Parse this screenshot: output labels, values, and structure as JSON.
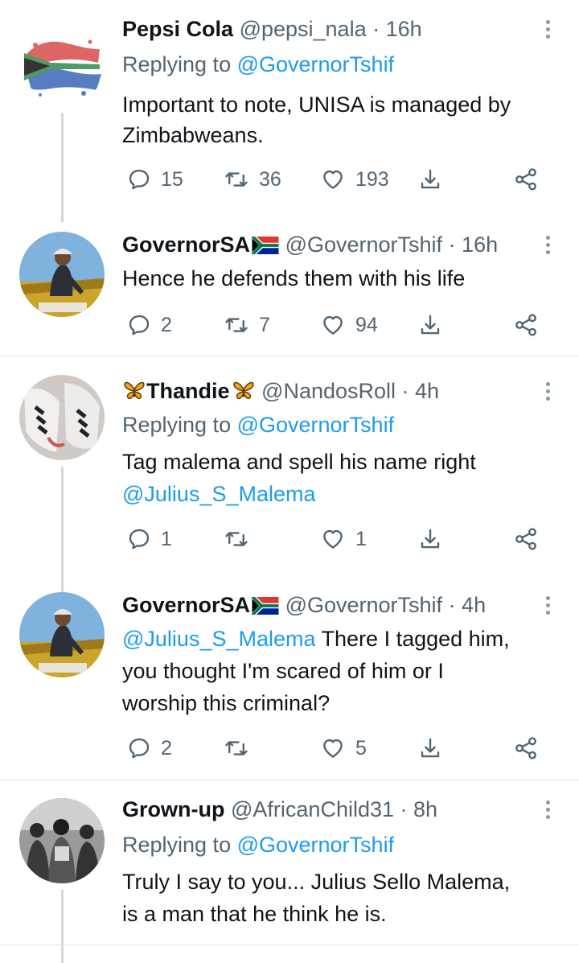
{
  "tweets": [
    {
      "name": "Pepsi Cola",
      "handle": "@pepsi_nala",
      "time": "16h",
      "replying_prefix": "Replying to ",
      "replying_to": "@GovernorTshif",
      "lines": [
        "Important to note, UNISA is managed by",
        "Zimbabweans."
      ],
      "replies": "15",
      "retweets": "36",
      "likes": "193",
      "avatar": "south-africa-flag-splash"
    },
    {
      "name": "GovernorSA",
      "handle": "@GovernorTshif",
      "time": "16h",
      "lines": [
        "Hence he defends them with his life"
      ],
      "replies": "2",
      "retweets": "7",
      "likes": "94",
      "avatar": "man-in-stadium-photo"
    },
    {
      "name": "Thandie",
      "name_decoration": "butterfly-emoji",
      "handle": "@NandosRoll",
      "time": "4h",
      "replying_prefix": "Replying to ",
      "replying_to": "@GovernorTshif",
      "lines": [
        "Tag malema and spell his name right"
      ],
      "mention_line": "@Julius_S_Malema",
      "replies": "1",
      "retweets": "",
      "likes": "1",
      "avatar": "sneakers-photo"
    },
    {
      "name": "GovernorSA",
      "handle": "@GovernorTshif",
      "time": "4h",
      "mention": "@Julius_S_Malema",
      "line1_rest": " There I tagged him,",
      "lines": [
        "you thought I'm scared of him or I",
        "worship this criminal?"
      ],
      "replies": "2",
      "retweets": "",
      "likes": "5",
      "avatar": "man-in-stadium-photo"
    },
    {
      "name": "Grown-up",
      "handle": "@AfricanChild31",
      "time": "8h",
      "replying_prefix": "Replying to ",
      "replying_to": "@GovernorTshif",
      "lines": [
        "Truly I say to you... Julius Sello Malema,",
        "is a man that he think he is."
      ],
      "avatar": "black-and-white-group-photo"
    }
  ],
  "separator": " · ",
  "colors": {
    "text": "#0f1419",
    "muted": "#536471",
    "link": "#1d9bf0",
    "thread_line": "#cfd9de",
    "divider": "#dfe3e6"
  },
  "icons": [
    "reply-icon",
    "retweet-icon",
    "like-icon",
    "share-icon",
    "more-icon",
    "south-africa-flag-emoji",
    "butterfly-emoji"
  ]
}
